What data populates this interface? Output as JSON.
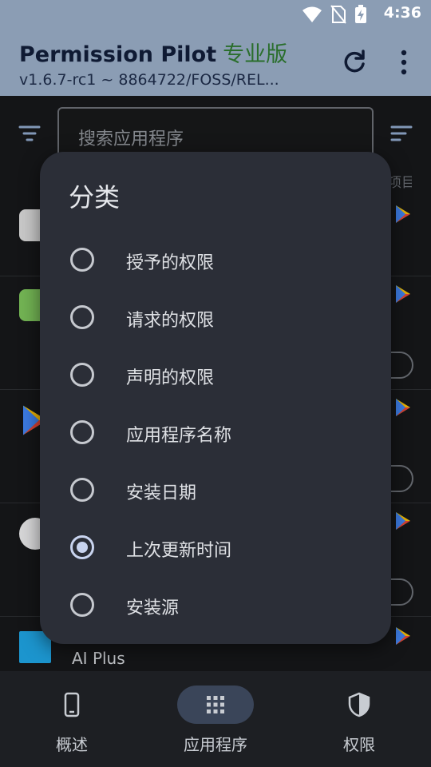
{
  "status_bar": {
    "time": "4:36"
  },
  "app_bar": {
    "title": "Permission Pilot",
    "title_suffix": "专业版",
    "subtitle": "v1.6.7-rc1 ~ 8864722/FOSS/REL..."
  },
  "search": {
    "placeholder": "搜索应用程序"
  },
  "list": {
    "items_label": "项目",
    "last_visible_app": "AI Plus"
  },
  "sort_dialog": {
    "title": "分类",
    "options": [
      {
        "label": "授予的权限",
        "selected": false
      },
      {
        "label": "请求的权限",
        "selected": false
      },
      {
        "label": "声明的权限",
        "selected": false
      },
      {
        "label": "应用程序名称",
        "selected": false
      },
      {
        "label": "安装日期",
        "selected": false
      },
      {
        "label": "上次更新时间",
        "selected": true
      },
      {
        "label": "安装源",
        "selected": false
      }
    ]
  },
  "bottom_nav": {
    "items": [
      {
        "label": "概述",
        "icon": "phone-icon",
        "active": false
      },
      {
        "label": "应用程序",
        "icon": "grid-icon",
        "active": true
      },
      {
        "label": "权限",
        "icon": "shield-icon",
        "active": false
      }
    ]
  },
  "colors": {
    "app_bar": "#8b9db4",
    "dialog": "#2b2e37",
    "accent": "#c9d4ef",
    "pro_green": "#2a6e2c"
  }
}
